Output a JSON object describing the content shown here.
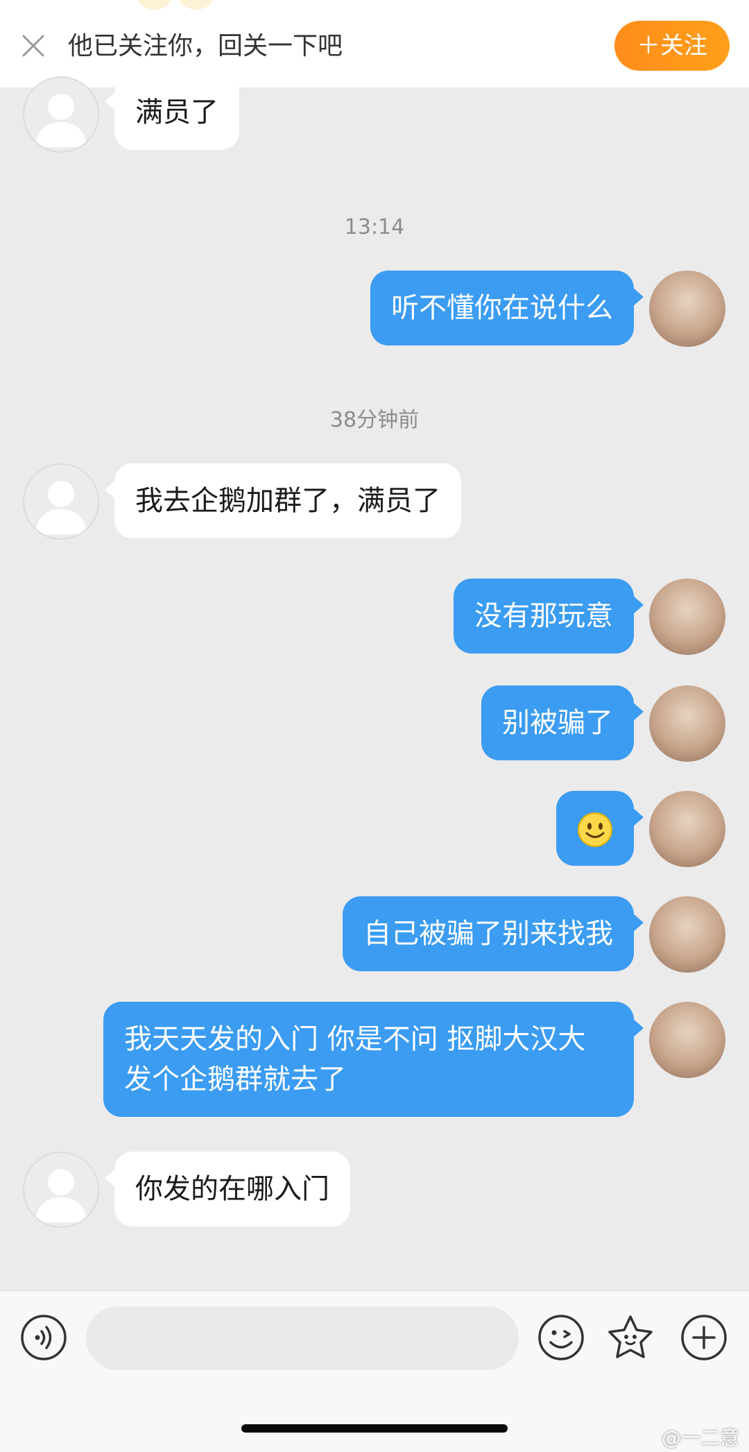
{
  "banner": {
    "text": "他已关注你，回关一下吧",
    "follow_button": "＋关注",
    "close_icon": "close-icon"
  },
  "conversation": {
    "messages": [
      {
        "side": "in",
        "text": "满员了"
      },
      {
        "timestamp": "13:14"
      },
      {
        "side": "out",
        "text": "听不懂你在说什么"
      },
      {
        "timestamp": "38分钟前"
      },
      {
        "side": "in",
        "text": "我去企鹅加群了，满员了"
      },
      {
        "side": "out",
        "text": "没有那玩意"
      },
      {
        "side": "out",
        "text": "别被骗了"
      },
      {
        "side": "out",
        "emoji": "smiley-face"
      },
      {
        "side": "out",
        "text": "自己被骗了别来找我"
      },
      {
        "side": "out",
        "text": "我天天发的入门 你是不问 抠脚大汉大发个企鹅群就去了"
      },
      {
        "side": "in",
        "text": "你发的在哪入门"
      }
    ]
  },
  "input_bar": {
    "placeholder": "",
    "icons": [
      "voice-icon",
      "emoji-icon",
      "sticker-icon",
      "add-icon"
    ]
  },
  "watermark": "@一二意",
  "colors": {
    "outgoing_bubble": "#3b9cf2",
    "incoming_bubble": "#ffffff",
    "follow_button": "#ff9419",
    "chat_background": "#ebebeb"
  }
}
